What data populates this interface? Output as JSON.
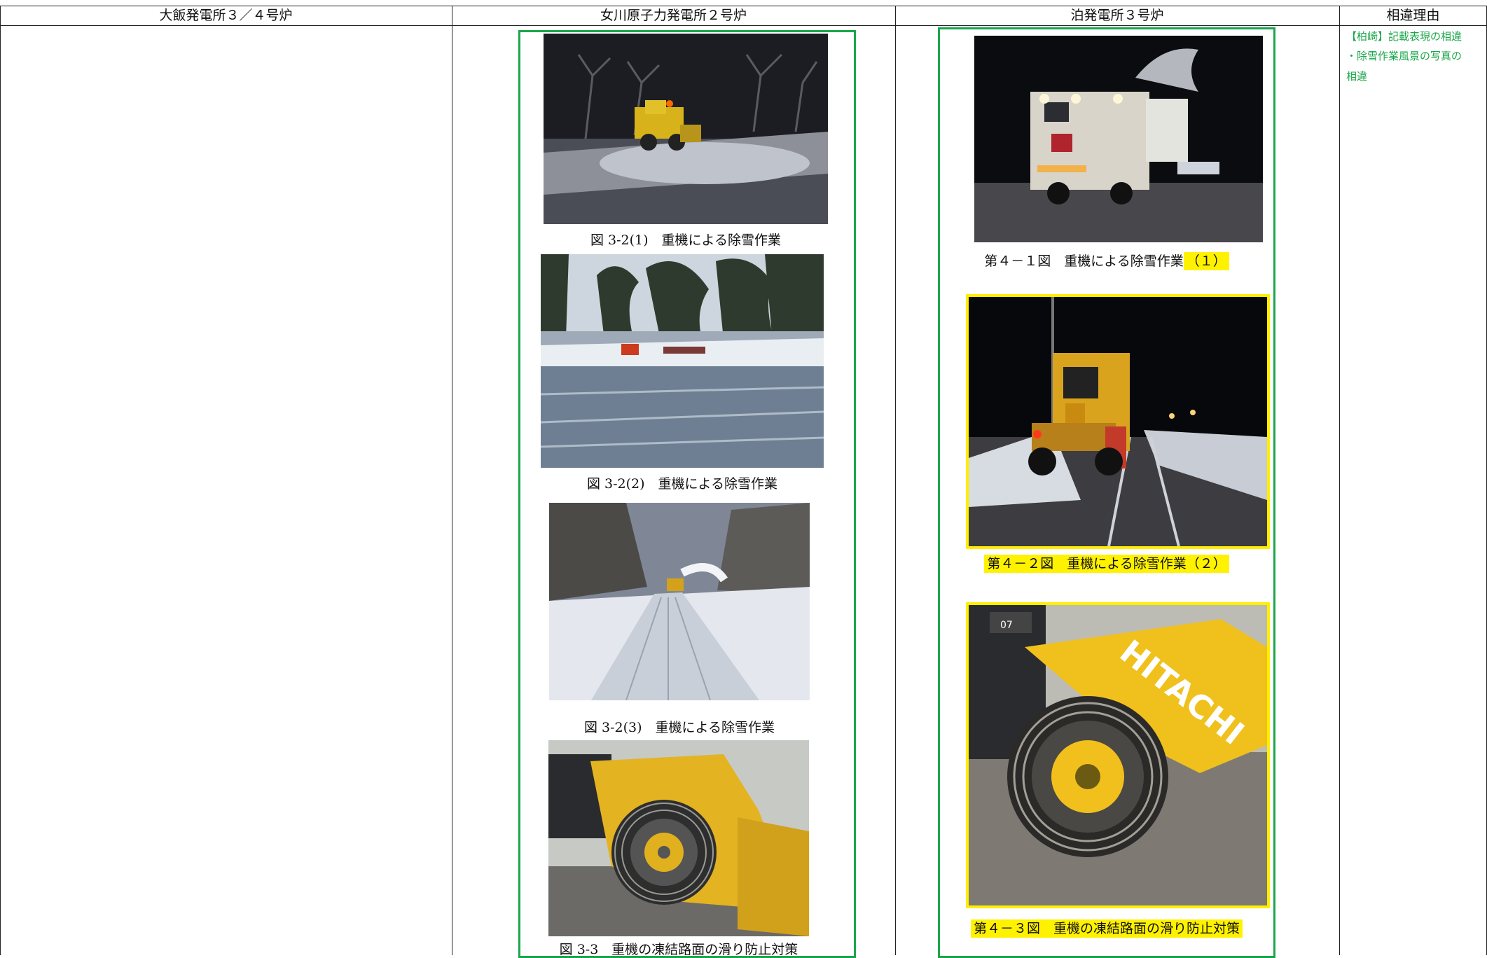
{
  "columns": {
    "ohi": "大飯発電所３／４号炉",
    "onagawa": "女川原子力発電所２号炉",
    "tomari": "泊発電所３号炉",
    "reason": "相違理由"
  },
  "onagawa": {
    "captions": [
      "図 3-2(1)　重機による除雪作業",
      "図 3-2(2)　重機による除雪作業",
      "図 3-2(3)　重機による除雪作業",
      "図 3-3　重機の凍結路面の滑り防止対策"
    ]
  },
  "tomari": {
    "caption1_main": "第４－１図　重機による除雪作業",
    "caption1_hl": "（１）",
    "caption2": "第４－２図　重機による除雪作業（２）",
    "caption3": "第４－３図　重機の凍結路面の滑り防止対策",
    "loader_text": "HITACHI",
    "loader_number": "07"
  },
  "reason": {
    "line1": "【柏崎】記載表現の相違",
    "line2": "・除雪作業風景の写真の",
    "line3": "相違"
  },
  "colors": {
    "green": "#1aa64a",
    "highlight": "#fff200"
  }
}
